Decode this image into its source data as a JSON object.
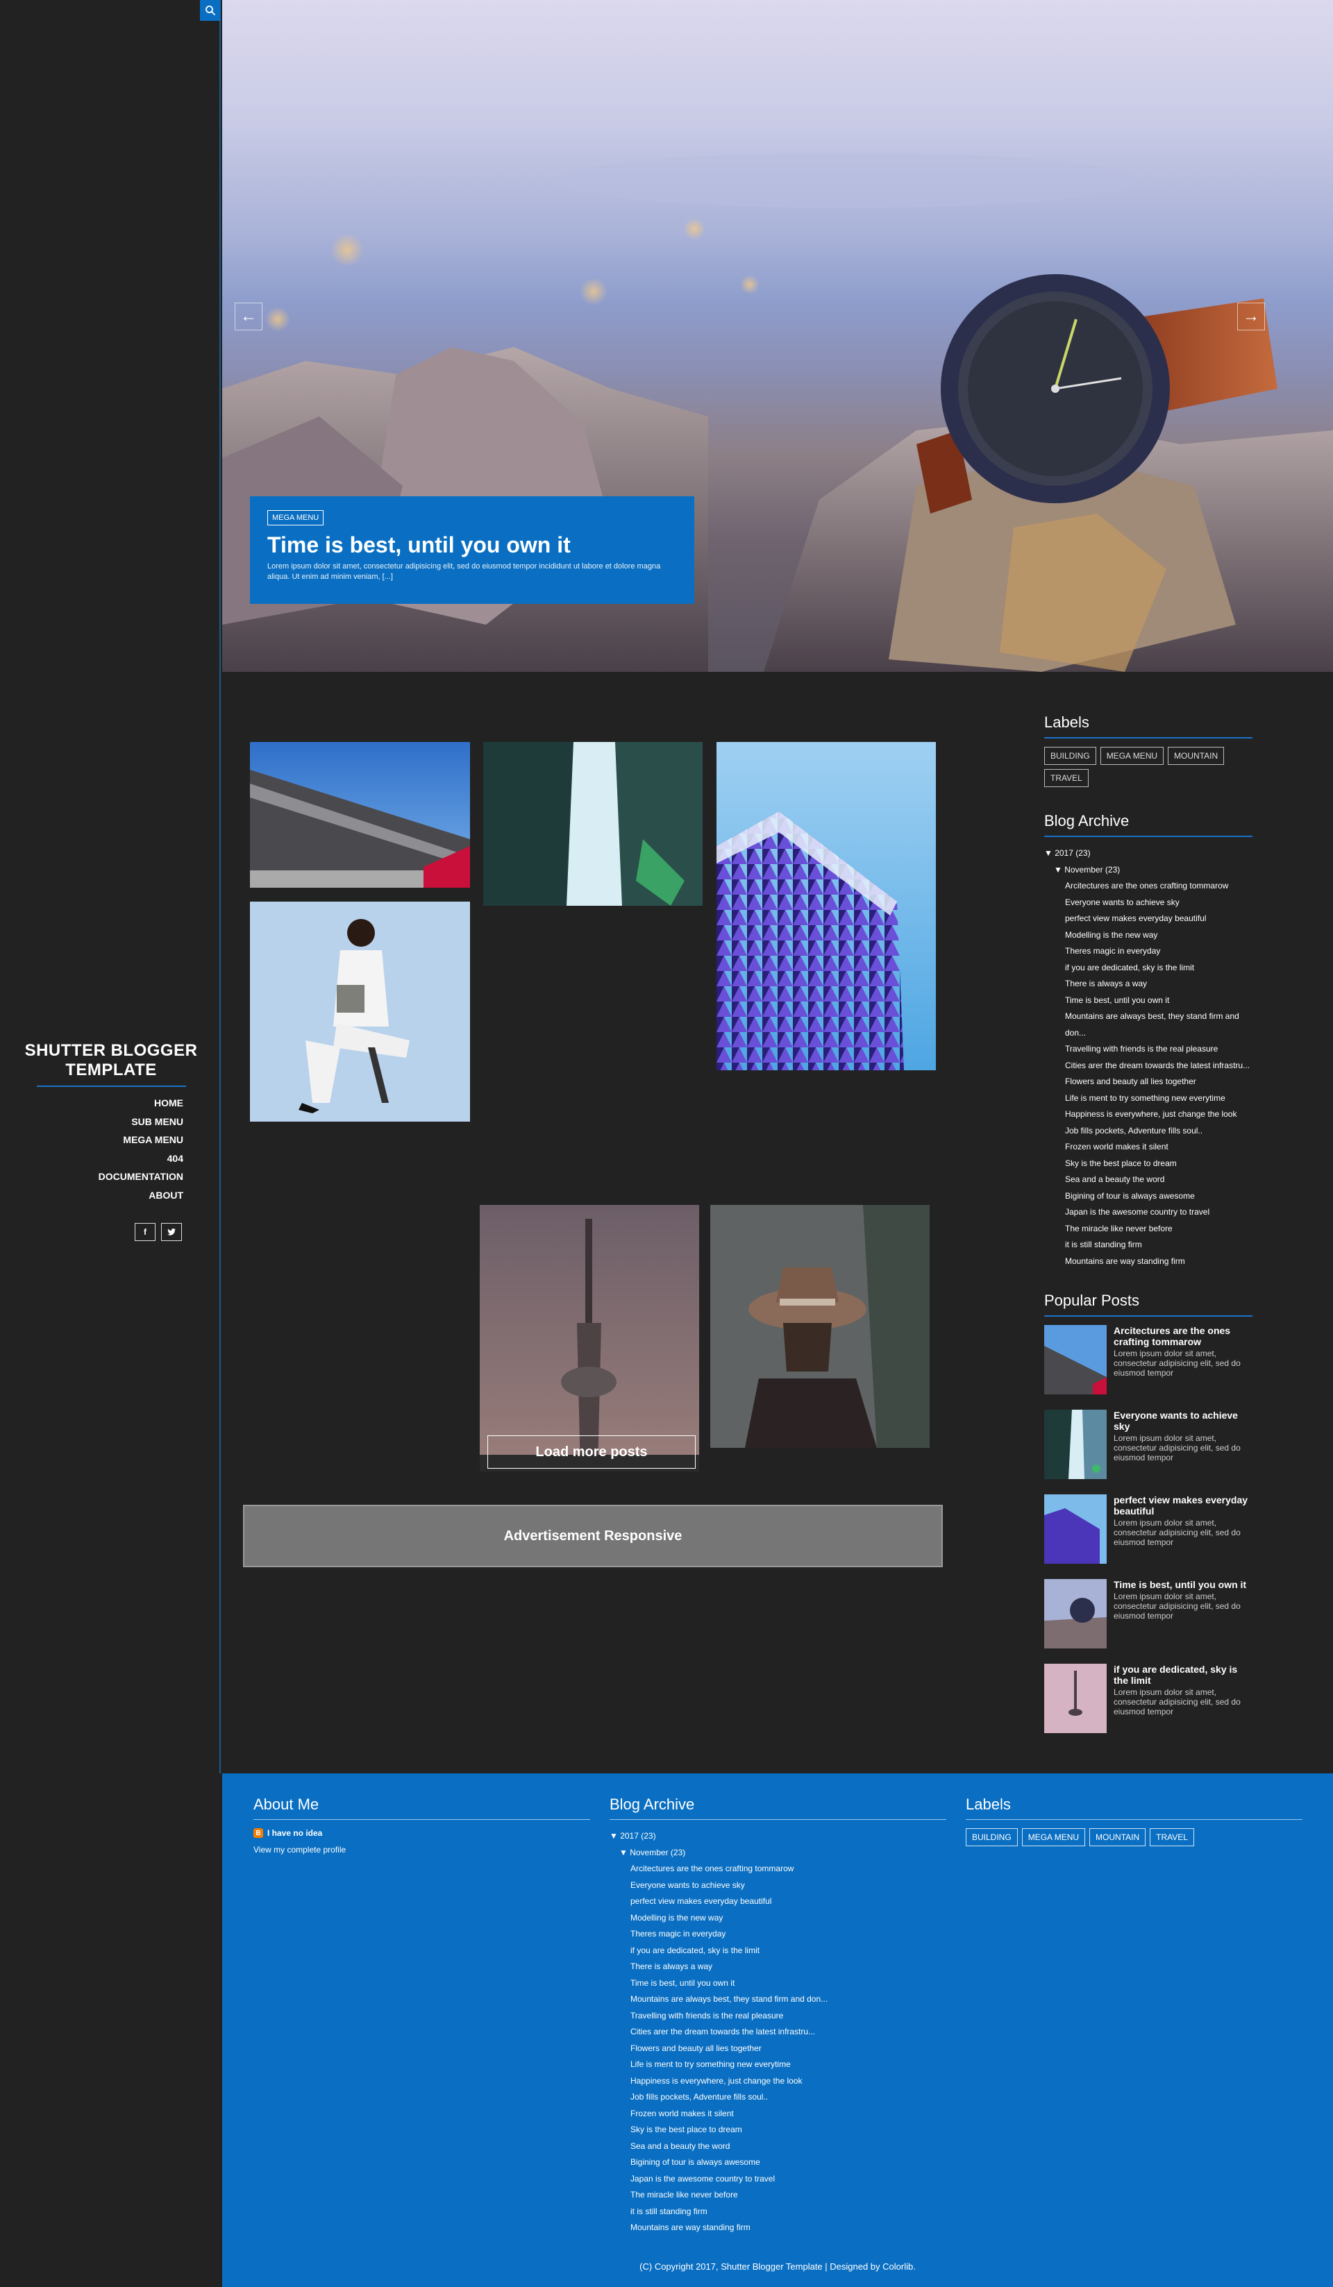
{
  "brand": {
    "title_line1": "SHUTTER BLOGGER",
    "title_line2": "TEMPLATE"
  },
  "menu": [
    "HOME",
    "SUB MENU",
    "MEGA MENU",
    "404",
    "DOCUMENTATION",
    "ABOUT"
  ],
  "social": {
    "facebook": "f",
    "twitter": "t"
  },
  "hero": {
    "tag": "MEGA MENU",
    "title": "Time is best, until you own it",
    "excerpt": "Lorem ipsum dolor sit amet, consectetur adipisicing elit, sed do eiusmod tempor incididunt ut labore et dolore magna aliqua. Ut enim ad minim veniam, [...]",
    "prev": "←",
    "next": "→"
  },
  "load_more": "Load more posts",
  "ad_text": "Advertisement Responsive",
  "labels": {
    "title": "Labels",
    "items": [
      "BUILDING",
      "MEGA MENU",
      "MOUNTAIN",
      "TRAVEL"
    ]
  },
  "archive": {
    "title": "Blog Archive",
    "year": "▼  2017 (23)",
    "month": "▼  November (23)",
    "posts": [
      "Arcitectures are the ones crafting tommarow",
      "Everyone wants to achieve sky",
      "perfect view makes everyday beautiful",
      "Modelling is the new way",
      "Theres magic in everyday",
      "if you are dedicated, sky is the limit",
      "There is always a way",
      "Time is best, until you own it",
      "Mountains are always best, they stand firm and don...",
      "Travelling with friends is the real pleasure",
      "Cities arer the dream towards the latest infrastru...",
      "Flowers and beauty all lies together",
      "Life is ment to try something new everytime",
      "Happiness is everywhere, just change the look",
      "Job fills pockets, Adventure fills soul..",
      "Frozen world makes it silent",
      "Sky is the best place to dream",
      "Sea and a beauty the word",
      "Bigining of tour is always awesome",
      "Japan is the awesome country to travel",
      "The miracle like never before",
      "it is still standing firm",
      "Mountains are way standing firm"
    ]
  },
  "popular": {
    "title": "Popular Posts",
    "items": [
      {
        "title": "Arcitectures are the ones crafting tommarow",
        "excerpt": "Lorem ipsum dolor sit amet, consectetur adipisicing elit, sed do eiusmod tempor"
      },
      {
        "title": "Everyone wants to achieve sky",
        "excerpt": "Lorem ipsum dolor sit amet, consectetur adipisicing elit, sed do eiusmod tempor"
      },
      {
        "title": "perfect view makes everyday beautiful",
        "excerpt": "Lorem ipsum dolor sit amet, consectetur adipisicing elit, sed do eiusmod tempor"
      },
      {
        "title": "Time is best, until you own it",
        "excerpt": "Lorem ipsum dolor sit amet, consectetur adipisicing elit, sed do eiusmod tempor"
      },
      {
        "title": "if you are dedicated, sky is the limit",
        "excerpt": "Lorem ipsum dolor sit amet, consectetur adipisicing elit, sed do eiusmod tempor"
      }
    ]
  },
  "footer": {
    "about_title": "About Me",
    "profile_name": "I have no idea",
    "profile_link": "View my complete profile",
    "archive_title": "Blog Archive",
    "labels_title": "Labels",
    "copyright": "(C) Copyright 2017, Shutter Blogger Template | Designed by Colorlib."
  },
  "colors": {
    "accent": "#0a6fc2",
    "background": "#222222",
    "advert": "#767676"
  }
}
